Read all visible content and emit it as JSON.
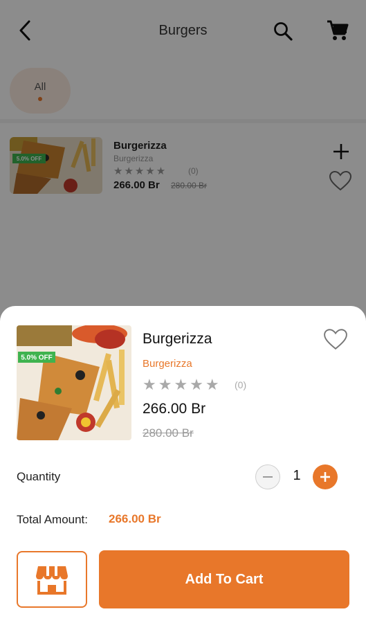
{
  "header": {
    "title": "Burgers",
    "back_icon": "back-arrow-icon",
    "search_icon": "search-icon",
    "cart_icon": "shopping-cart-icon"
  },
  "categories": [
    {
      "label": "All",
      "selected": true
    }
  ],
  "list_item": {
    "name": "Burgerizza",
    "subtitle": "Burgerizza",
    "rating": 0,
    "rating_count": "(0)",
    "price": "266.00 Br",
    "old_price": "280.00 Br",
    "discount_badge": "5.0% OFF"
  },
  "sheet": {
    "name": "Burgerizza",
    "subtitle": "Burgerizza",
    "rating": 0,
    "rating_count": "(0)",
    "price": "266.00 Br",
    "old_price": "280.00 Br",
    "discount_badge": "5.0% OFF",
    "quantity_label": "Quantity",
    "quantity": "1",
    "total_label": "Total Amount:",
    "total_value": "266.00 Br",
    "add_to_cart_label": "Add To Cart"
  },
  "colors": {
    "accent": "#e8772a",
    "badge_green": "#3fb34f"
  }
}
